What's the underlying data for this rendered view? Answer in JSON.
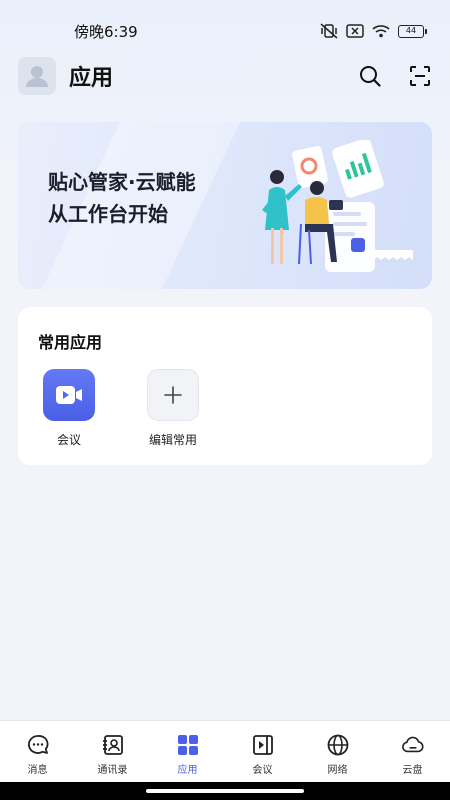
{
  "status": {
    "time": "傍晚6:39",
    "battery": "44"
  },
  "header": {
    "title": "应用"
  },
  "banner": {
    "line1": "贴心管家·云赋能",
    "line2": "从工作台开始"
  },
  "apps": {
    "title": "常用应用",
    "items": [
      {
        "label": "会议",
        "icon": "video-camera-icon"
      },
      {
        "label": "编辑常用",
        "icon": "plus-icon"
      }
    ]
  },
  "tabs": [
    {
      "label": "消息",
      "icon": "chat-bubble-icon",
      "active": false
    },
    {
      "label": "通讯录",
      "icon": "contacts-book-icon",
      "active": false
    },
    {
      "label": "应用",
      "icon": "apps-grid-icon",
      "active": true
    },
    {
      "label": "会议",
      "icon": "meeting-play-icon",
      "active": false
    },
    {
      "label": "网络",
      "icon": "globe-icon",
      "active": false
    },
    {
      "label": "云盘",
      "icon": "cloud-icon",
      "active": false
    }
  ],
  "colors": {
    "accent": "#4b60e6",
    "meeting_icon_bg": "#5a6ff0"
  }
}
